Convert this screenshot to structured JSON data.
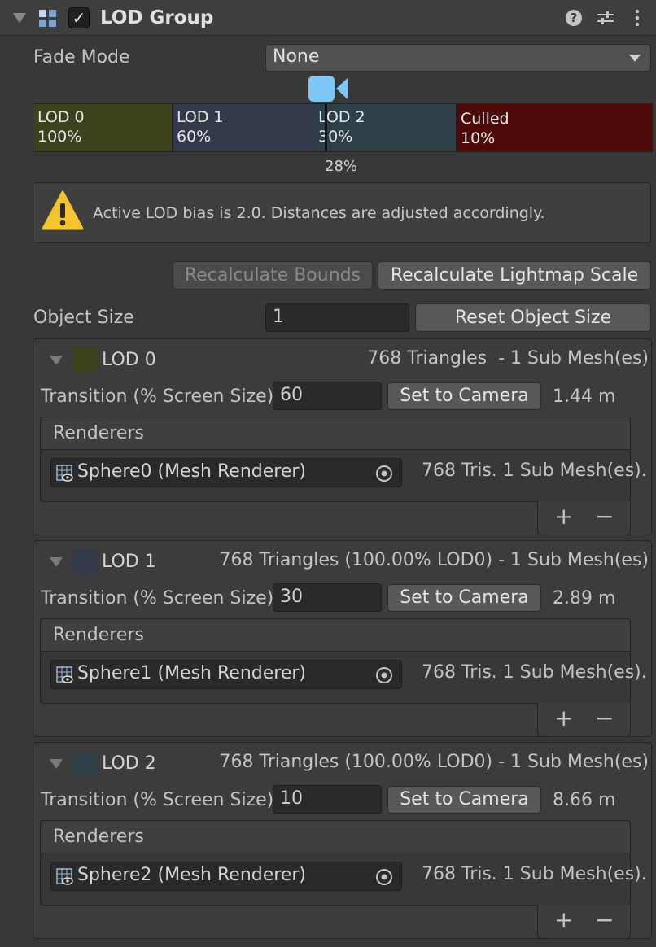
{
  "header": {
    "title": "LOD Group",
    "enabled_mark": "✓",
    "icons": [
      "component-icon",
      "help-icon",
      "presets-icon",
      "more-icon"
    ]
  },
  "fade_mode": {
    "label": "Fade Mode",
    "value": "None"
  },
  "lod_bar": {
    "segments": [
      {
        "name": "LOD 0",
        "percent": "100%",
        "color": "#3d411d"
      },
      {
        "name": "LOD 1",
        "percent": "60%",
        "color": "#323948"
      },
      {
        "name": "LOD 2",
        "percent": "30%",
        "color": "#2e3f47"
      },
      {
        "name": "Culled",
        "percent": "10%",
        "color": "#4d0a08"
      }
    ],
    "current_marker": "28%",
    "camera_icon_color": "#7ec8f5"
  },
  "help": {
    "text": "Active LOD bias is 2.0. Distances are adjusted accordingly."
  },
  "buttons": {
    "recalculate_bounds": "Recalculate Bounds",
    "recalculate_lightmap": "Recalculate Lightmap Scale",
    "reset_object_size": "Reset Object Size"
  },
  "object_size": {
    "label": "Object Size",
    "value": "1"
  },
  "lods": [
    {
      "name": "LOD 0",
      "swatch": "#3d411d",
      "summary": "768 Triangles  - 1 Sub Mesh(es)",
      "transition_label": "Transition (% Screen Size)",
      "transition_value": "60",
      "set_camera": "Set to Camera",
      "distance": "1.44 m",
      "renderers_label": "Renderers",
      "renderer": "Sphere0 (Mesh Renderer)",
      "renderer_info": "768 Tris. 1 Sub Mesh(es)."
    },
    {
      "name": "LOD 1",
      "swatch": "#323948",
      "summary": "768 Triangles (100.00% LOD0) - 1 Sub Mesh(es)",
      "transition_label": "Transition (% Screen Size)",
      "transition_value": "30",
      "set_camera": "Set to Camera",
      "distance": "2.89 m",
      "renderers_label": "Renderers",
      "renderer": "Sphere1 (Mesh Renderer)",
      "renderer_info": "768 Tris. 1 Sub Mesh(es)."
    },
    {
      "name": "LOD 2",
      "swatch": "#2e3f47",
      "summary": "768 Triangles (100.00% LOD0) - 1 Sub Mesh(es)",
      "transition_label": "Transition (% Screen Size)",
      "transition_value": "10",
      "set_camera": "Set to Camera",
      "distance": "8.66 m",
      "renderers_label": "Renderers",
      "renderer": "Sphere2 (Mesh Renderer)",
      "renderer_info": "768 Tris. 1 Sub Mesh(es)."
    }
  ],
  "list_controls": {
    "add": "+",
    "remove": "−"
  }
}
